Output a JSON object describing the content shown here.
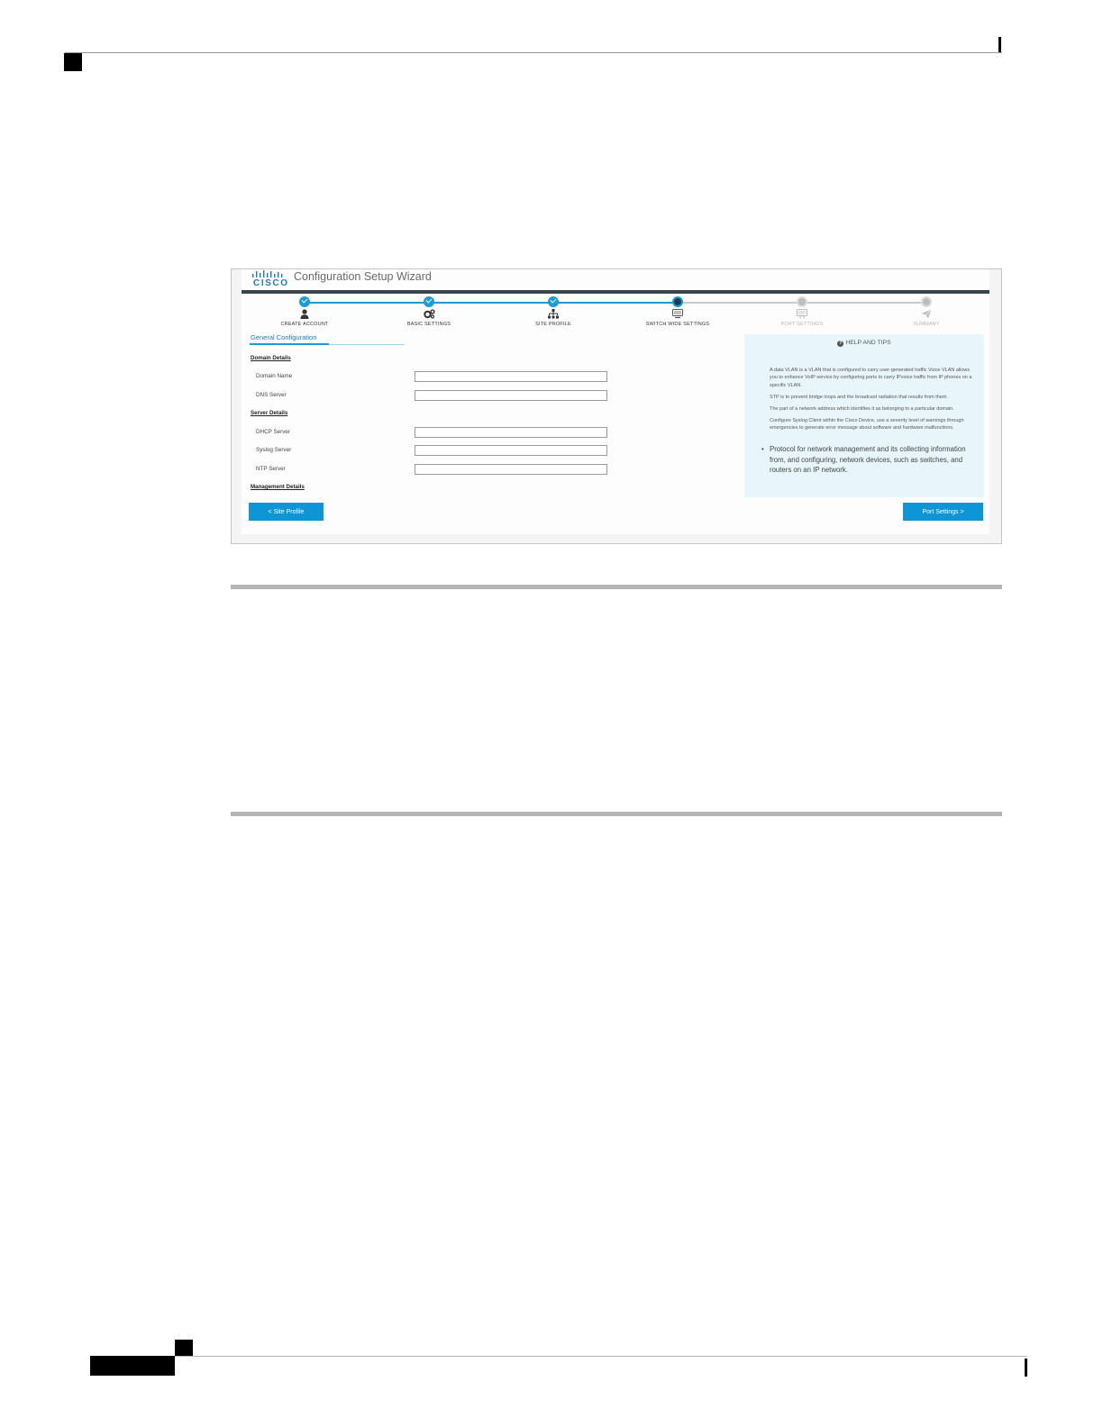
{
  "wizard": {
    "logo_text": "CISCO",
    "title": "Configuration Setup Wizard",
    "steps": [
      {
        "label": "CREATE ACCOUNT",
        "state": "done",
        "icon": "user-icon"
      },
      {
        "label": "BASIC SETTINGS",
        "state": "done",
        "icon": "gears-icon"
      },
      {
        "label": "SITE PROFILE",
        "state": "done",
        "icon": "sitemap-icon"
      },
      {
        "label": "SWITCH WIDE SETTINGS",
        "state": "current",
        "icon": "switch-icon"
      },
      {
        "label": "PORT SETTINGS",
        "state": "todo",
        "icon": "port-icon"
      },
      {
        "label": "SUMMARY",
        "state": "todo",
        "icon": "paper-plane-icon"
      }
    ],
    "tab": "General Configuration",
    "sections": {
      "domain": "Domain Details",
      "server": "Server Details",
      "management": "Management Details"
    },
    "fields": {
      "domain_name": {
        "label": "Domain Name",
        "value": ""
      },
      "dns_server": {
        "label": "DNS Server",
        "value": ""
      },
      "dhcp_server": {
        "label": "DHCP Server",
        "value": ""
      },
      "syslog_server": {
        "label": "Syslog Server",
        "value": ""
      },
      "ntp_server": {
        "label": "NTP Server",
        "value": ""
      }
    },
    "help": {
      "title": "HELP AND TIPS",
      "paragraphs": [
        "A data VLAN is a VLAN that is configured to carry user-generated traffic Voice VLAN allows you to enhance VoIP service by configuring ports to carry IPvoice traffic from IP phones on a specific VLAN.",
        "STP is to prevent bridge loops and the broadcast radiation that results from them.",
        "The part of a network address which identifies it as belonging to a particular domain.",
        "Configure Syslog Client within the Cisco Device, use a severity level of warnings through emergencies to generate error message about software and hardware malfunctions."
      ],
      "bullet": "Protocol for network management and its collecting information from, and configuring, network devices, such as switches, and routers on an IP network."
    },
    "buttons": {
      "back": "< Site Profile",
      "next": "Port Settings >"
    },
    "colors": {
      "accent": "#1b9bd7",
      "button": "#0e95d5",
      "header_bar": "#36454f",
      "help_bg": "#e8f6fc"
    }
  }
}
